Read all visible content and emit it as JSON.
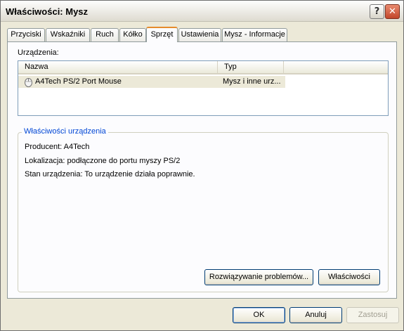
{
  "window": {
    "title": "Właściwości: Mysz",
    "help_label": "?",
    "close_label": "✕"
  },
  "tabs": [
    {
      "label": "Przyciski"
    },
    {
      "label": "Wskaźniki"
    },
    {
      "label": "Ruch"
    },
    {
      "label": "Kółko"
    },
    {
      "label": "Sprzęt",
      "active": true
    },
    {
      "label": "Ustawienia"
    },
    {
      "label": "Mysz - Informacje"
    }
  ],
  "devices": {
    "label": "Urządzenia:",
    "columns": [
      "Nazwa",
      "Typ"
    ],
    "rows": [
      {
        "name": "A4Tech PS/2 Port Mouse",
        "type": "Mysz i inne urz..."
      }
    ]
  },
  "properties": {
    "title": "Właściwości urządzenia",
    "manufacturer": "Producent: A4Tech",
    "location": "Lokalizacja: podłączone do portu myszy PS/2",
    "status": "Stan urządzenia: To urządzenie działa poprawnie.",
    "troubleshoot_label": "Rozwiązywanie problemów...",
    "properties_label": "Właściwości"
  },
  "footer": {
    "ok_label": "OK",
    "cancel_label": "Anuluj",
    "apply_label": "Zastosuj"
  },
  "colors": {
    "accent": "#0046d5",
    "tab_highlight": "#e68b2c",
    "selection": "#ece9d8"
  }
}
